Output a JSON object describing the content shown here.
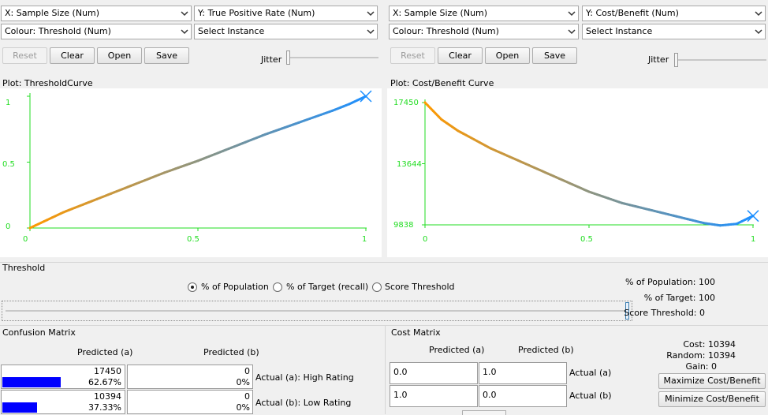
{
  "left": {
    "x_combo": "X: Sample Size (Num)",
    "y_combo": "Y: True Positive Rate (Num)",
    "colour_combo": "Colour: Threshold (Num)",
    "instance_combo": "Select Instance",
    "buttons": {
      "reset": "Reset",
      "clear": "Clear",
      "open": "Open",
      "save": "Save"
    },
    "jitter_label": "Jitter",
    "plot_title": "Plot: ThresholdCurve",
    "y_ticks": [
      "1",
      "0.5",
      "0"
    ],
    "x_ticks": [
      "0",
      "0.5",
      "1"
    ]
  },
  "right": {
    "x_combo": "X: Sample Size (Num)",
    "y_combo": "Y: Cost/Benefit (Num)",
    "colour_combo": "Colour: Threshold (Num)",
    "instance_combo": "Select Instance",
    "buttons": {
      "reset": "Reset",
      "clear": "Clear",
      "open": "Open",
      "save": "Save"
    },
    "jitter_label": "Jitter",
    "plot_title": "Plot: Cost/Benefit Curve",
    "y_ticks": [
      "17450",
      "13644",
      "9838"
    ],
    "x_ticks": [
      "0",
      "0.5",
      "1"
    ]
  },
  "threshold": {
    "section_label": "Threshold",
    "radio_population": "% of Population",
    "radio_target": "% of Target (recall)",
    "radio_score": "Score Threshold",
    "selected": "population",
    "slider_value": 1.0,
    "stat_population": "% of Population: 100",
    "stat_target": "% of Target: 100",
    "stat_score": "Score Threshold: 0"
  },
  "confusion": {
    "title": "Confusion Matrix",
    "col_a": "Predicted (a)",
    "col_b": "Predicted (b)",
    "rows": [
      {
        "a_count": "17450",
        "a_pct": "62.67%",
        "a_fraction": 0.6267,
        "b_count": "0",
        "b_pct": "0%",
        "label": "Actual (a): High Rating"
      },
      {
        "a_count": "10394",
        "a_pct": "37.33%",
        "a_fraction": 0.3733,
        "b_count": "0",
        "b_pct": "0%",
        "label": "Actual (b): Low Rating"
      }
    ],
    "bar_color": "#0000ff"
  },
  "cost": {
    "title": "Cost Matrix",
    "col_a": "Predicted (a)",
    "col_b": "Predicted (b)",
    "rows": [
      {
        "a": "0.0",
        "b": "1.0",
        "label": "Actual (a)"
      },
      {
        "a": "1.0",
        "b": "0.0",
        "label": "Actual (b)"
      }
    ],
    "cost_stat": "Cost: 10394",
    "random_stat": "Random: 10394",
    "gain_stat": "Gain: 0",
    "maximize_button": "Maximize Cost/Benefit",
    "minimize_button": "Minimize Cost/Benefit"
  },
  "colors": {
    "axis": "#22dd22",
    "curve_low": "#ff9900",
    "curve_high": "#1e90ff"
  },
  "chart_data": [
    {
      "type": "scatter",
      "title": "Plot: ThresholdCurve",
      "xlabel": "Sample Size",
      "ylabel": "True Positive Rate",
      "xlim": [
        0,
        1
      ],
      "ylim": [
        0,
        1
      ],
      "x": [
        0,
        0.05,
        0.1,
        0.2,
        0.3,
        0.4,
        0.5,
        0.6,
        0.7,
        0.8,
        0.9,
        0.95,
        1.0
      ],
      "y": [
        0,
        0.06,
        0.12,
        0.22,
        0.32,
        0.42,
        0.51,
        0.61,
        0.71,
        0.8,
        0.89,
        0.94,
        1.0
      ]
    },
    {
      "type": "scatter",
      "title": "Plot: Cost/Benefit Curve",
      "xlabel": "Sample Size",
      "ylabel": "Cost/Benefit",
      "xlim": [
        0,
        1
      ],
      "ylim": [
        9838,
        17450
      ],
      "x": [
        0,
        0.05,
        0.1,
        0.2,
        0.3,
        0.4,
        0.5,
        0.6,
        0.7,
        0.8,
        0.85,
        0.9,
        0.95,
        1.0
      ],
      "y": [
        17450,
        16400,
        15700,
        14600,
        13700,
        12800,
        11900,
        11200,
        10700,
        10200,
        9950,
        9800,
        9900,
        10394
      ]
    }
  ]
}
